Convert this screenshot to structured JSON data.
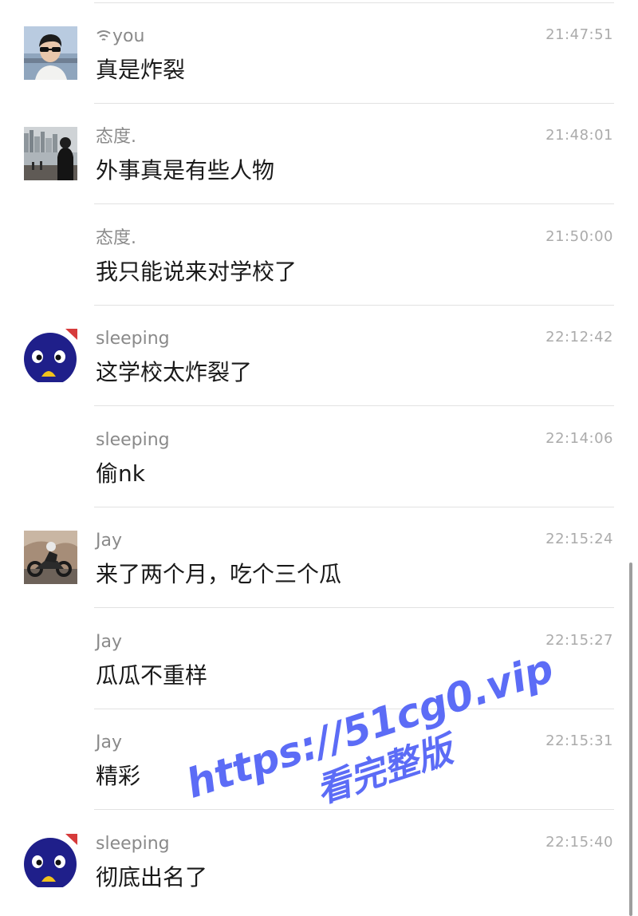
{
  "messages": [
    {
      "sender": "you",
      "sender_prefix_icon": "wifi-icon",
      "time": "21:47:51",
      "text": "真是炸裂",
      "avatar": "avatar-sunglasses-man"
    },
    {
      "sender": "态度.",
      "time": "21:48:01",
      "text": "外事真是有些人物",
      "avatar": "avatar-city-riverside"
    },
    {
      "sender": "态度.",
      "time": "21:50:00",
      "text": "我只能说来对学校了",
      "avatar": null
    },
    {
      "sender": "sleeping",
      "time": "22:12:42",
      "text": "这学校太炸裂了",
      "avatar": "avatar-blue-penguin"
    },
    {
      "sender": "sleeping",
      "time": "22:14:06",
      "text": "偷nk",
      "avatar": null
    },
    {
      "sender": "Jay",
      "time": "22:15:24",
      "text": "来了两个月，吃个三个瓜",
      "avatar": "avatar-motorcycle"
    },
    {
      "sender": "Jay",
      "time": "22:15:27",
      "text": "瓜瓜不重样",
      "avatar": null
    },
    {
      "sender": "Jay",
      "time": "22:15:31",
      "text": "精彩",
      "avatar": null
    },
    {
      "sender": "sleeping",
      "time": "22:15:40",
      "text": "彻底出名了",
      "avatar": "avatar-blue-penguin"
    }
  ],
  "watermark": {
    "line1": "https://51cg0.vip",
    "line2": "看完整版",
    "color": "#5c6cf6"
  }
}
